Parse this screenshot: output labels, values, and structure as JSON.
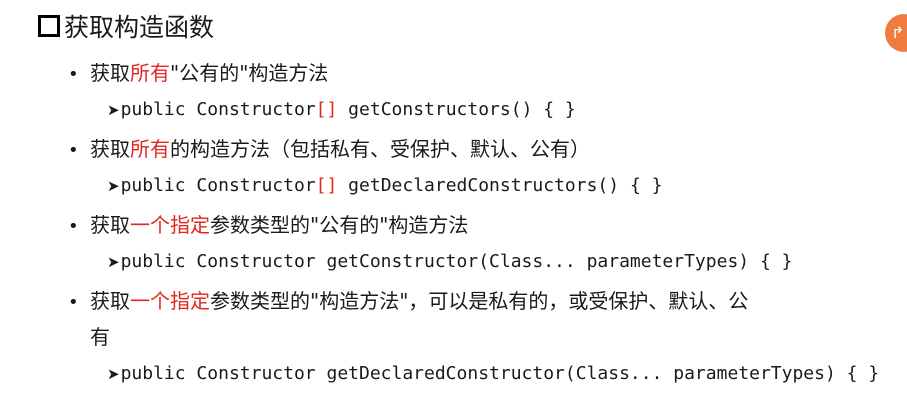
{
  "title": "获取构造函数",
  "items": [
    {
      "pre": "获取",
      "red": "所有",
      "post": "\"公有的\"构造方法",
      "code_a": "public Constructor",
      "code_red": "[]",
      "code_b": " getConstructors() { }"
    },
    {
      "pre": "获取",
      "red": "所有",
      "post": "的构造方法（包括私有、受保护、默认、公有）",
      "code_a": "public Constructor",
      "code_red": "[]",
      "code_b": " getDeclaredConstructors() { }"
    },
    {
      "pre": "获取",
      "red": "一个指定",
      "post": "参数类型的\"公有的\"构造方法",
      "code": "public Constructor getConstructor(Class... parameterTypes) { }"
    },
    {
      "pre": "获取",
      "red": "一个指定",
      "post": "参数类型的\"构造方法\"，可以是私有的，或受保护、默认、公",
      "cont": "有",
      "code": "public Constructor getDeclaredConstructor(Class... parameterTypes) { }"
    }
  ],
  "colors": {
    "accent": "#e3261f",
    "corner_badge": "#f07b3f"
  },
  "corner_icon": "exit-icon"
}
